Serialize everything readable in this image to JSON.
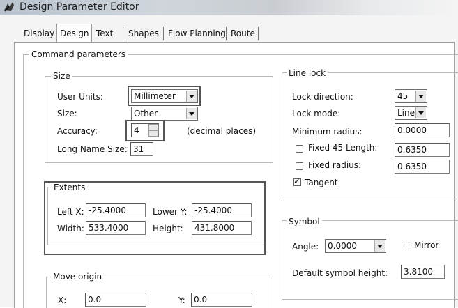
{
  "window": {
    "title": "Design Parameter Editor"
  },
  "tabs": [
    {
      "label": "Display"
    },
    {
      "label": "Design"
    },
    {
      "label": "Text"
    },
    {
      "label": "Shapes"
    },
    {
      "label": "Flow Planning"
    },
    {
      "label": "Route"
    }
  ],
  "command_parameters": {
    "legend": "Command parameters",
    "size": {
      "legend": "Size",
      "user_units_label": "User Units:",
      "user_units_value": "Millimeter",
      "size_label": "Size:",
      "size_value": "Other",
      "accuracy_label": "Accuracy:",
      "accuracy_value": "4",
      "accuracy_suffix": "(decimal places)",
      "long_name_label": "Long Name Size:",
      "long_name_value": "31"
    },
    "extents": {
      "legend": "Extents",
      "left_x_label": "Left X:",
      "left_x_value": "-25.4000",
      "lower_y_label": "Lower Y:",
      "lower_y_value": "-25.4000",
      "width_label": "Width:",
      "width_value": "533.4000",
      "height_label": "Height:",
      "height_value": "431.8000"
    },
    "move_origin": {
      "legend": "Move origin",
      "x_label": "X:",
      "x_value": "0.0",
      "y_label": "Y:",
      "y_value": "0.0"
    },
    "line_lock": {
      "legend": "Line lock",
      "lock_direction_label": "Lock direction:",
      "lock_direction_value": "45",
      "lock_mode_label": "Lock mode:",
      "lock_mode_value": "Line",
      "min_radius_label": "Minimum radius:",
      "min_radius_value": "0.0000",
      "fixed45_label": "Fixed 45 Length:",
      "fixed45_value": "0.6350",
      "fixed45_checked": false,
      "fixed_radius_label": "Fixed radius:",
      "fixed_radius_value": "0.6350",
      "fixed_radius_checked": false,
      "tangent_label": "Tangent",
      "tangent_checked": true,
      "checkmark_glyph": "✓"
    },
    "symbol": {
      "legend": "Symbol",
      "angle_label": "Angle:",
      "angle_value": "0.0000",
      "mirror_label": "Mirror",
      "mirror_checked": false,
      "default_height_label": "Default symbol height:",
      "default_height_value": "3.8100"
    }
  }
}
